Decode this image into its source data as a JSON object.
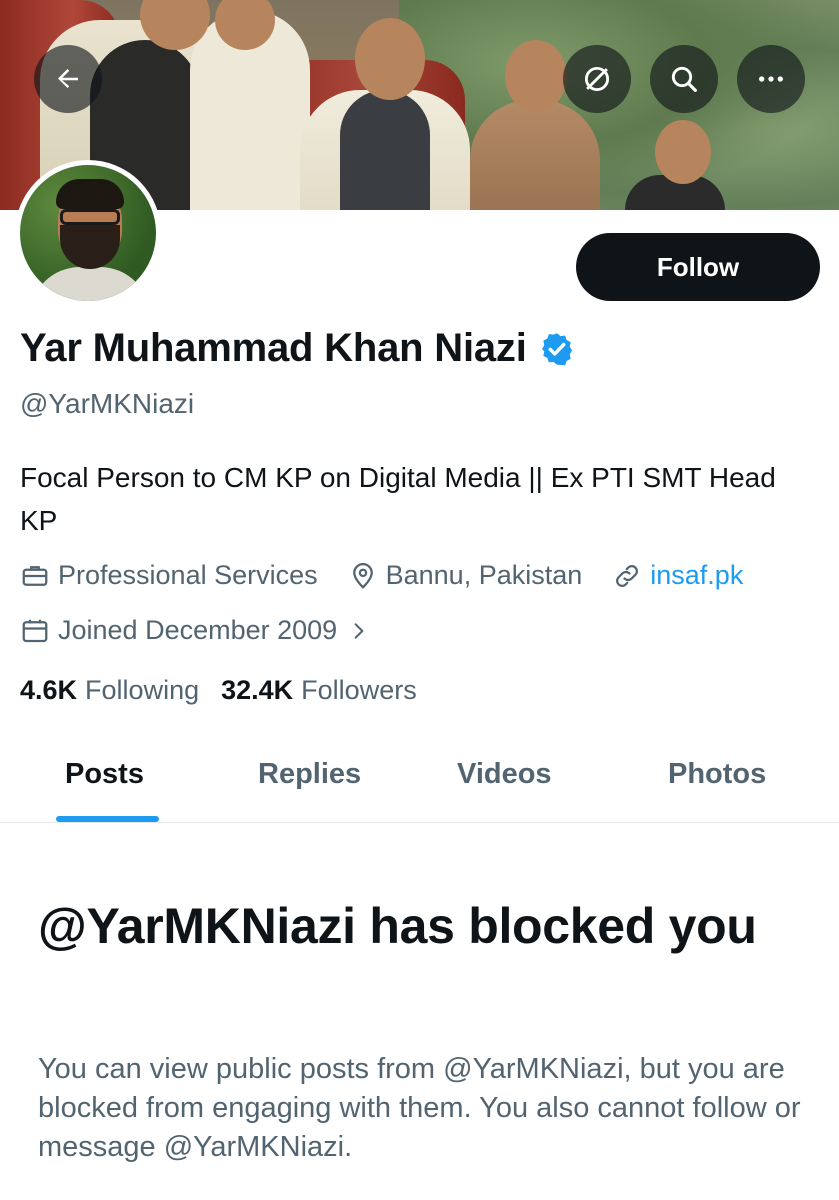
{
  "header": {
    "back_icon": "arrow-left-icon",
    "hide_icon": "eye-slash-circle-icon",
    "search_icon": "search-icon",
    "more_icon": "more-horizontal-icon"
  },
  "profile": {
    "display_name": "Yar Muhammad Khan Niazi",
    "handle": "@YarMKNiazi",
    "verified": true,
    "bio": "Focal Person to CM KP on Digital Media || Ex PTI SMT Head KP",
    "category": "Professional Services",
    "location": "Bannu, Pakistan",
    "website": "insaf.pk",
    "joined": "Joined December 2009",
    "following_count": "4.6K",
    "following_label": "Following",
    "followers_count": "32.4K",
    "followers_label": "Followers"
  },
  "actions": {
    "follow_label": "Follow"
  },
  "tabs": [
    {
      "label": "Posts",
      "active": true
    },
    {
      "label": "Replies",
      "active": false
    },
    {
      "label": "Videos",
      "active": false
    },
    {
      "label": "Photos",
      "active": false
    }
  ],
  "blocked": {
    "title": "@YarMKNiazi has blocked you",
    "message": "You can view public posts from @YarMKNiazi, but you are blocked from engaging with them. You also cannot follow or message @YarMKNiazi."
  },
  "colors": {
    "accent": "#1d9bf0",
    "text_primary": "#0f1419",
    "text_secondary": "#536471",
    "button_dark": "#0f1419"
  }
}
